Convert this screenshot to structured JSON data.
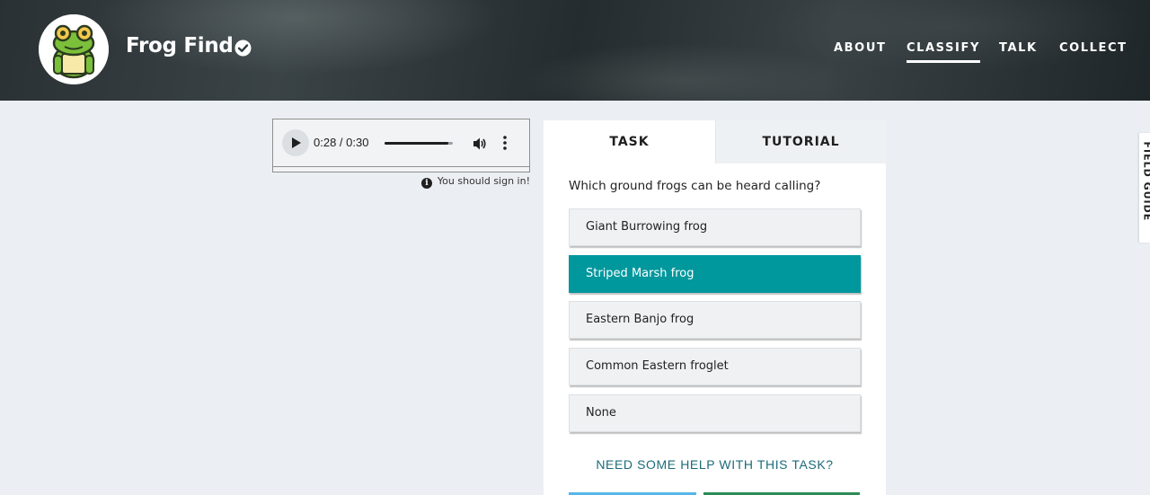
{
  "header": {
    "project_title": "Frog Find",
    "logo_icon": "frog-logo-icon",
    "verified_icon": "verified-check-icon",
    "nav": [
      {
        "label": "ABOUT",
        "active": false
      },
      {
        "label": "CLASSIFY",
        "active": true
      },
      {
        "label": "TALK",
        "active": false
      },
      {
        "label": "COLLECT",
        "active": false
      }
    ]
  },
  "audio": {
    "time": "0:28 / 0:30",
    "progress": 0.93,
    "play_icon": "play-icon",
    "volume_icon": "volume-icon",
    "menu_icon": "more-vert-icon"
  },
  "signin_note": "You should sign in!",
  "task_panel": {
    "tabs": [
      {
        "label": "TASK",
        "active": true
      },
      {
        "label": "TUTORIAL",
        "active": false
      }
    ],
    "question": "Which ground frogs can be heard calling?",
    "answers": [
      {
        "label": "Giant Burrowing frog",
        "selected": false
      },
      {
        "label": "Striped Marsh frog",
        "selected": true
      },
      {
        "label": "Eastern Banjo frog",
        "selected": false
      },
      {
        "label": "Common Eastern froglet",
        "selected": false
      },
      {
        "label": "None",
        "selected": false
      }
    ],
    "help_link": "NEED SOME HELP WITH THIS TASK?"
  },
  "field_guide": {
    "label": "FIELD GUIDE"
  },
  "colors": {
    "accent": "#00979d",
    "help_link": "#1c6b79",
    "background": "#ebeff4"
  }
}
